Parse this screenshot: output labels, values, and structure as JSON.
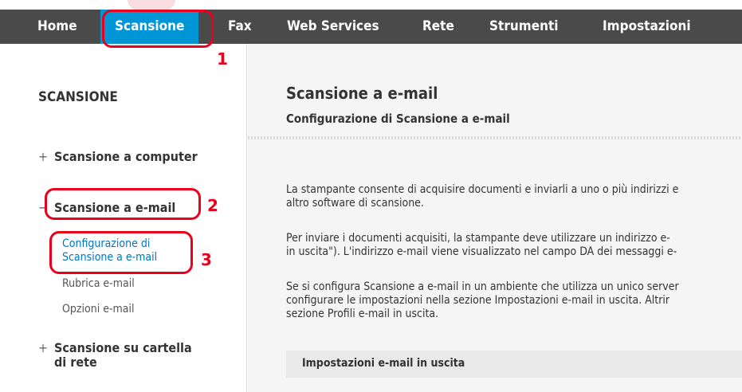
{
  "nav": {
    "items": [
      "Home",
      "Scansione",
      "Fax",
      "Web Services",
      "Rete",
      "Strumenti",
      "Impostazioni"
    ],
    "active_index": 1
  },
  "annotations": [
    "1",
    "2",
    "3"
  ],
  "sidebar": {
    "title": "SCANSIONE",
    "groups": [
      {
        "sign": "+",
        "label": "Scansione a computer"
      },
      {
        "sign": "−",
        "label": "Scansione a e-mail"
      },
      {
        "sign": "+",
        "label_line1": "Scansione su cartella",
        "label_line2": "di rete"
      }
    ],
    "sub_items": [
      {
        "line1": "Configurazione di",
        "line2": "Scansione a e-mail"
      },
      {
        "label": "Rubrica e-mail"
      },
      {
        "label": "Opzioni e-mail"
      }
    ]
  },
  "main": {
    "title": "Scansione a e-mail",
    "subtitle": "Configurazione di Scansione a e-mail",
    "paragraphs": [
      [
        "La stampante consente di acquisire documenti e inviarli a uno o più indirizzi e",
        "altro software di scansione."
      ],
      [
        "Per inviare i documenti acquisiti, la stampante deve utilizzare un indirizzo e-",
        "in uscita\"). L'indirizzo e-mail viene visualizzato nel campo DA dei messaggi e-"
      ],
      [
        "Se si configura Scansione a e-mail in un ambiente che utilizza un unico server",
        "configurare le impostazioni nella sezione Impostazioni e-mail in uscita. Altrir",
        "sezione Profili e-mail in uscita."
      ]
    ],
    "section_header": "Impostazioni e-mail in uscita"
  },
  "colors": {
    "nav_bg": "#4a4a4a",
    "nav_active": "#0096d6",
    "link": "#0076c0",
    "annotation": "#e8001c"
  }
}
